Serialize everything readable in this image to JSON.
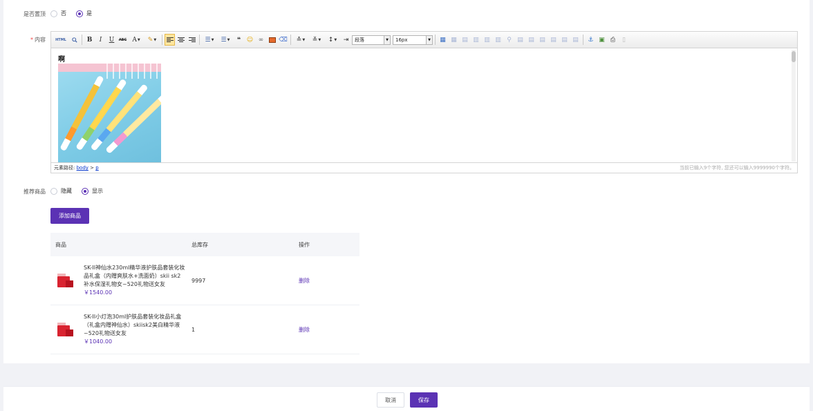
{
  "pin": {
    "label": "是否置顶",
    "options": [
      {
        "label": "否",
        "checked": false
      },
      {
        "label": "是",
        "checked": true
      }
    ]
  },
  "content": {
    "label": "内容",
    "required_mark": "*",
    "text": "啊",
    "toolbar": {
      "html_label": "HTML",
      "bold": "B",
      "italic": "I",
      "underline": "U",
      "strike": "ABC",
      "fontcolor": "A",
      "paragraph_value": "段落",
      "fontsize_value": "16px"
    },
    "status_prefix": "元素路径: ",
    "path_body": "body",
    "path_sep": " > ",
    "path_p": "p",
    "count_text": "当前已输入9个字符, 您还可以输入9999990个字符。"
  },
  "recommend": {
    "label": "推荐商品",
    "options": [
      {
        "label": "隐藏",
        "checked": false
      },
      {
        "label": "显示",
        "checked": true
      }
    ],
    "add_button": "添加商品"
  },
  "table": {
    "headers": [
      "商品",
      "总库存",
      "操作"
    ],
    "rows": [
      {
        "name": "SK-II神仙水230ml精华液护肤品套装化妆品礼盒（内赠爽肤水+洗面奶）skii sk2 补水保湿礼物女~520礼物送女友",
        "price": "￥1540.00",
        "stock": "9997",
        "action": "删除"
      },
      {
        "name": "SK-II小灯泡30ml护肤品套装化妆品礼盒（礼盒内赠神仙水）skiisk2美白精华液~520礼物送女友",
        "price": "￥1040.00",
        "stock": "1",
        "action": "删除"
      }
    ]
  },
  "footer": {
    "cancel": "取消",
    "save": "保存"
  },
  "colors": {
    "accent": "#5b32b4",
    "required": "#f04444"
  }
}
